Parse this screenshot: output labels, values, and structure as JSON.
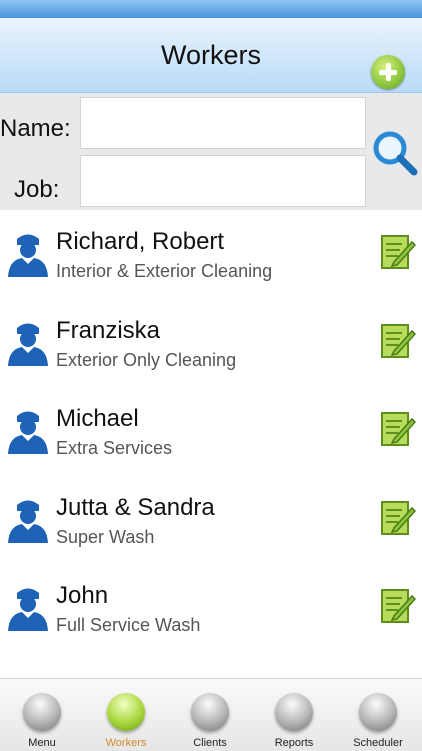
{
  "header": {
    "title": "Workers"
  },
  "search": {
    "name_label": "Name:",
    "job_label": "Job:",
    "name_value": "",
    "job_value": ""
  },
  "workers": [
    {
      "name": "Richard, Robert",
      "job": "Interior & Exterior Cleaning"
    },
    {
      "name": "Franziska",
      "job": "Exterior Only Cleaning"
    },
    {
      "name": "Michael",
      "job": "Extra Services"
    },
    {
      "name": "Jutta & Sandra",
      "job": "Super Wash"
    },
    {
      "name": "John",
      "job": "Full Service Wash"
    }
  ],
  "tabs": [
    {
      "label": "Menu",
      "active": false
    },
    {
      "label": "Workers",
      "active": true
    },
    {
      "label": "Clients",
      "active": false
    },
    {
      "label": "Reports",
      "active": false
    },
    {
      "label": "Scheduler",
      "active": false
    }
  ],
  "colors": {
    "header_bg": "#cfe6fa",
    "accent_green": "#8cc63f",
    "avatar_blue": "#1e63b5",
    "active_tab_text": "#d68a2b"
  },
  "icons": {
    "add": "plus-icon",
    "search": "magnifier-icon",
    "worker": "worker-avatar-icon",
    "edit": "edit-note-icon"
  }
}
